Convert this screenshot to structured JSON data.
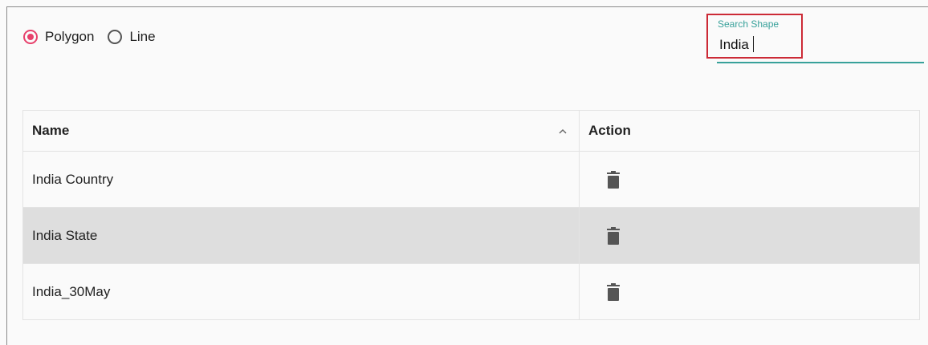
{
  "shape_type": {
    "options": [
      {
        "label": "Polygon",
        "selected": true
      },
      {
        "label": "Line",
        "selected": false
      }
    ]
  },
  "search": {
    "label": "Search Shape",
    "value": "India"
  },
  "table": {
    "columns": {
      "name": "Name",
      "action": "Action"
    },
    "rows": [
      {
        "name": "India Country",
        "action_icon": "trash-icon",
        "selected": false
      },
      {
        "name": "India State",
        "action_icon": "trash-icon",
        "selected": true
      },
      {
        "name": "India_30May",
        "action_icon": "trash-icon",
        "selected": false
      }
    ]
  },
  "colors": {
    "accent_radio": "#e7416c",
    "accent_search": "#38a19a",
    "highlight_box": "#cc2a36",
    "selected_row": "#dedede"
  }
}
